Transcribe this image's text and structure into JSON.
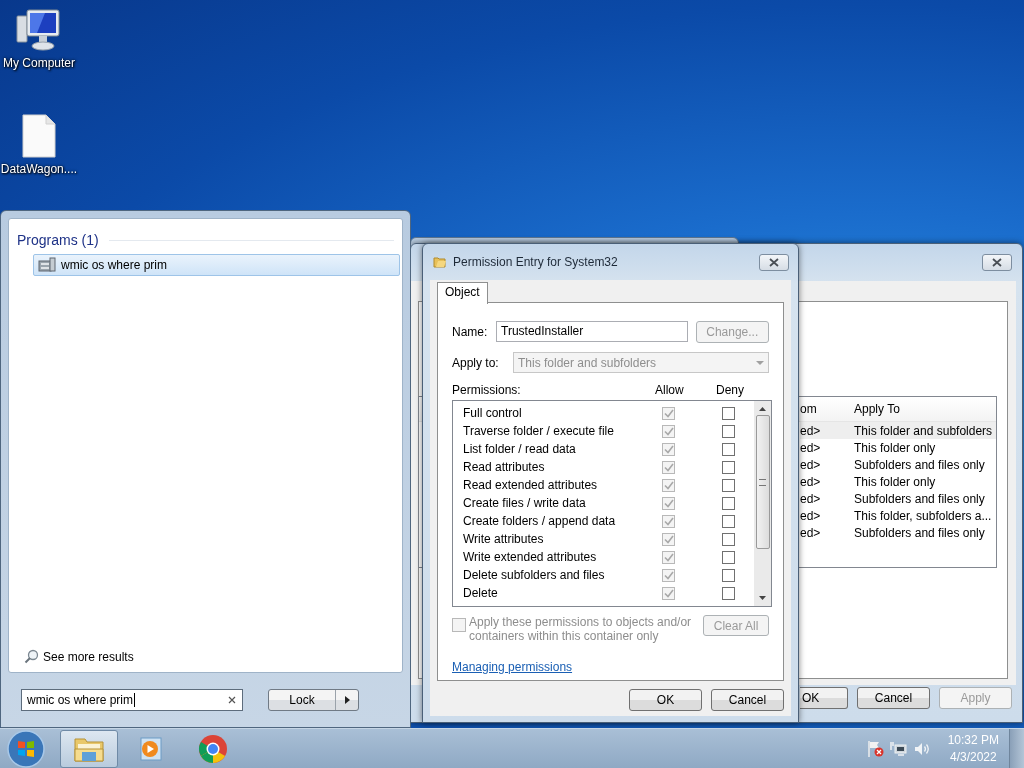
{
  "desktop_icons": [
    {
      "label": "My Computer",
      "kind": "computer"
    },
    {
      "label": "DataWagon....",
      "kind": "file"
    }
  ],
  "start_menu": {
    "section_title": "Programs (1)",
    "results": [
      {
        "label": "wmic os where prim",
        "selected": true
      }
    ],
    "see_more": "See more results",
    "search": {
      "value": "wmic os where prim"
    },
    "power_button": "Lock"
  },
  "security_window": {
    "columns": [
      "om",
      "Apply To"
    ],
    "rows": [
      {
        "cells": [
          "ed>",
          "This folder and subfolders"
        ],
        "selected": true
      },
      {
        "cells": [
          "ed>",
          "This folder only"
        ],
        "selected": false
      },
      {
        "cells": [
          "ed>",
          "Subfolders and files only"
        ],
        "selected": false
      },
      {
        "cells": [
          "ed>",
          "This folder only"
        ],
        "selected": false
      },
      {
        "cells": [
          "ed>",
          "Subfolders and files only"
        ],
        "selected": false
      },
      {
        "cells": [
          "ed>",
          "This folder, subfolders a..."
        ],
        "selected": false
      },
      {
        "cells": [
          "ed>",
          "Subfolders and files only"
        ],
        "selected": false
      }
    ],
    "buttons": [
      {
        "label": "OK",
        "disabled": false
      },
      {
        "label": "Cancel",
        "disabled": false
      },
      {
        "label": "Apply",
        "disabled": true
      }
    ]
  },
  "permission_dialog": {
    "title": "Permission Entry for System32",
    "tabs": [
      {
        "label": "Object",
        "selected": true
      }
    ],
    "name": {
      "label": "Name:",
      "value": "TrustedInstaller"
    },
    "change_button": {
      "label": "Change...",
      "disabled": true
    },
    "apply_to": {
      "label": "Apply to:",
      "value": "This folder and subfolders",
      "disabled": true
    },
    "permissions_label": "Permissions:",
    "allow_header": "Allow",
    "deny_header": "Deny",
    "permissions": [
      {
        "label": "Full control",
        "allow": true,
        "allow_disabled": true,
        "deny": false
      },
      {
        "label": "Traverse folder / execute file",
        "allow": true,
        "allow_disabled": true,
        "deny": false
      },
      {
        "label": "List folder / read data",
        "allow": true,
        "allow_disabled": true,
        "deny": false
      },
      {
        "label": "Read attributes",
        "allow": true,
        "allow_disabled": true,
        "deny": false
      },
      {
        "label": "Read extended attributes",
        "allow": true,
        "allow_disabled": true,
        "deny": false
      },
      {
        "label": "Create files / write data",
        "allow": true,
        "allow_disabled": true,
        "deny": false
      },
      {
        "label": "Create folders / append data",
        "allow": true,
        "allow_disabled": true,
        "deny": false
      },
      {
        "label": "Write attributes",
        "allow": true,
        "allow_disabled": true,
        "deny": false
      },
      {
        "label": "Write extended attributes",
        "allow": true,
        "allow_disabled": true,
        "deny": false
      },
      {
        "label": "Delete subfolders and files",
        "allow": true,
        "allow_disabled": true,
        "deny": false
      },
      {
        "label": "Delete",
        "allow": true,
        "allow_disabled": true,
        "deny": false
      }
    ],
    "apply_inherit": {
      "label": "Apply these permissions to objects and/or containers within this container only",
      "checked": false,
      "disabled": true
    },
    "clear_button": {
      "label": "Clear All",
      "disabled": true
    },
    "help_link": "Managing permissions",
    "buttons": [
      {
        "label": "OK",
        "disabled": false
      },
      {
        "label": "Cancel",
        "disabled": false
      }
    ]
  },
  "taskbar": {
    "apps": [
      {
        "kind": "explorer",
        "active": true
      },
      {
        "kind": "media",
        "active": false
      },
      {
        "kind": "browser",
        "active": false
      }
    ],
    "clock": {
      "time": "10:32 PM",
      "date": "4/3/2022"
    }
  }
}
